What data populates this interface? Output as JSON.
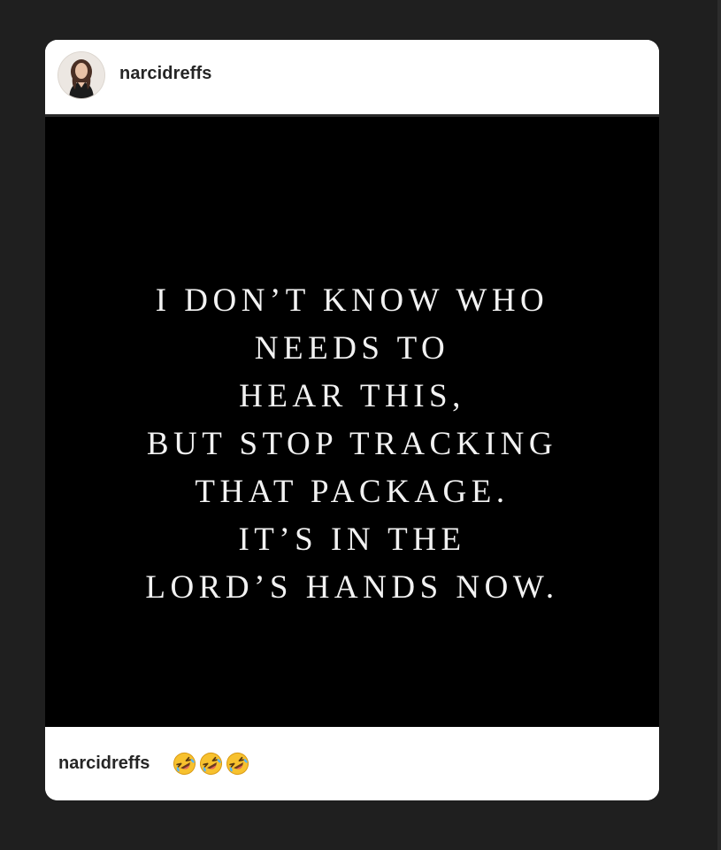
{
  "post": {
    "header": {
      "username": "narcidreffs",
      "avatar_icon": "profile-photo"
    },
    "image": {
      "background_color": "#000000",
      "text_color": "#f2f2f2",
      "quote_lines": [
        "I DON’T KNOW WHO",
        "NEEDS TO",
        "HEAR THIS,",
        "BUT STOP TRACKING",
        "THAT PACKAGE.",
        "IT’S IN THE",
        "LORD’S HANDS NOW."
      ]
    },
    "caption": {
      "username": "narcidreffs",
      "emojis": [
        "rolling-on-the-floor-laughing",
        "rolling-on-the-floor-laughing",
        "rolling-on-the-floor-laughing"
      ]
    }
  }
}
